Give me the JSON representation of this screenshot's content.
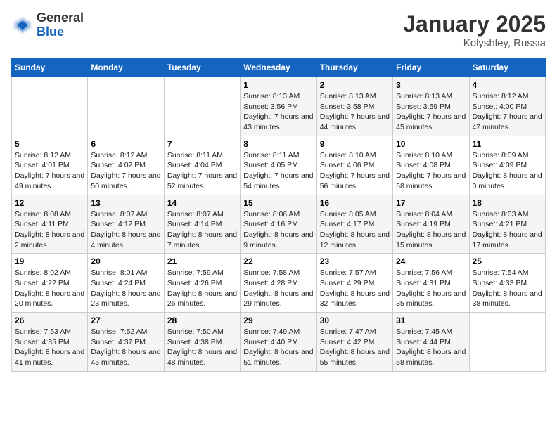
{
  "header": {
    "logo_general": "General",
    "logo_blue": "Blue",
    "month_title": "January 2025",
    "location": "Kolyshley, Russia"
  },
  "days_of_week": [
    "Sunday",
    "Monday",
    "Tuesday",
    "Wednesday",
    "Thursday",
    "Friday",
    "Saturday"
  ],
  "weeks": [
    [
      {
        "day": "",
        "sunrise": "",
        "sunset": "",
        "daylight": ""
      },
      {
        "day": "",
        "sunrise": "",
        "sunset": "",
        "daylight": ""
      },
      {
        "day": "",
        "sunrise": "",
        "sunset": "",
        "daylight": ""
      },
      {
        "day": "1",
        "sunrise": "Sunrise: 8:13 AM",
        "sunset": "Sunset: 3:56 PM",
        "daylight": "Daylight: 7 hours and 43 minutes."
      },
      {
        "day": "2",
        "sunrise": "Sunrise: 8:13 AM",
        "sunset": "Sunset: 3:58 PM",
        "daylight": "Daylight: 7 hours and 44 minutes."
      },
      {
        "day": "3",
        "sunrise": "Sunrise: 8:13 AM",
        "sunset": "Sunset: 3:59 PM",
        "daylight": "Daylight: 7 hours and 45 minutes."
      },
      {
        "day": "4",
        "sunrise": "Sunrise: 8:12 AM",
        "sunset": "Sunset: 4:00 PM",
        "daylight": "Daylight: 7 hours and 47 minutes."
      }
    ],
    [
      {
        "day": "5",
        "sunrise": "Sunrise: 8:12 AM",
        "sunset": "Sunset: 4:01 PM",
        "daylight": "Daylight: 7 hours and 49 minutes."
      },
      {
        "day": "6",
        "sunrise": "Sunrise: 8:12 AM",
        "sunset": "Sunset: 4:02 PM",
        "daylight": "Daylight: 7 hours and 50 minutes."
      },
      {
        "day": "7",
        "sunrise": "Sunrise: 8:11 AM",
        "sunset": "Sunset: 4:04 PM",
        "daylight": "Daylight: 7 hours and 52 minutes."
      },
      {
        "day": "8",
        "sunrise": "Sunrise: 8:11 AM",
        "sunset": "Sunset: 4:05 PM",
        "daylight": "Daylight: 7 hours and 54 minutes."
      },
      {
        "day": "9",
        "sunrise": "Sunrise: 8:10 AM",
        "sunset": "Sunset: 4:06 PM",
        "daylight": "Daylight: 7 hours and 56 minutes."
      },
      {
        "day": "10",
        "sunrise": "Sunrise: 8:10 AM",
        "sunset": "Sunset: 4:08 PM",
        "daylight": "Daylight: 7 hours and 58 minutes."
      },
      {
        "day": "11",
        "sunrise": "Sunrise: 8:09 AM",
        "sunset": "Sunset: 4:09 PM",
        "daylight": "Daylight: 8 hours and 0 minutes."
      }
    ],
    [
      {
        "day": "12",
        "sunrise": "Sunrise: 8:08 AM",
        "sunset": "Sunset: 4:11 PM",
        "daylight": "Daylight: 8 hours and 2 minutes."
      },
      {
        "day": "13",
        "sunrise": "Sunrise: 8:07 AM",
        "sunset": "Sunset: 4:12 PM",
        "daylight": "Daylight: 8 hours and 4 minutes."
      },
      {
        "day": "14",
        "sunrise": "Sunrise: 8:07 AM",
        "sunset": "Sunset: 4:14 PM",
        "daylight": "Daylight: 8 hours and 7 minutes."
      },
      {
        "day": "15",
        "sunrise": "Sunrise: 8:06 AM",
        "sunset": "Sunset: 4:16 PM",
        "daylight": "Daylight: 8 hours and 9 minutes."
      },
      {
        "day": "16",
        "sunrise": "Sunrise: 8:05 AM",
        "sunset": "Sunset: 4:17 PM",
        "daylight": "Daylight: 8 hours and 12 minutes."
      },
      {
        "day": "17",
        "sunrise": "Sunrise: 8:04 AM",
        "sunset": "Sunset: 4:19 PM",
        "daylight": "Daylight: 8 hours and 15 minutes."
      },
      {
        "day": "18",
        "sunrise": "Sunrise: 8:03 AM",
        "sunset": "Sunset: 4:21 PM",
        "daylight": "Daylight: 8 hours and 17 minutes."
      }
    ],
    [
      {
        "day": "19",
        "sunrise": "Sunrise: 8:02 AM",
        "sunset": "Sunset: 4:22 PM",
        "daylight": "Daylight: 8 hours and 20 minutes."
      },
      {
        "day": "20",
        "sunrise": "Sunrise: 8:01 AM",
        "sunset": "Sunset: 4:24 PM",
        "daylight": "Daylight: 8 hours and 23 minutes."
      },
      {
        "day": "21",
        "sunrise": "Sunrise: 7:59 AM",
        "sunset": "Sunset: 4:26 PM",
        "daylight": "Daylight: 8 hours and 26 minutes."
      },
      {
        "day": "22",
        "sunrise": "Sunrise: 7:58 AM",
        "sunset": "Sunset: 4:28 PM",
        "daylight": "Daylight: 8 hours and 29 minutes."
      },
      {
        "day": "23",
        "sunrise": "Sunrise: 7:57 AM",
        "sunset": "Sunset: 4:29 PM",
        "daylight": "Daylight: 8 hours and 32 minutes."
      },
      {
        "day": "24",
        "sunrise": "Sunrise: 7:56 AM",
        "sunset": "Sunset: 4:31 PM",
        "daylight": "Daylight: 8 hours and 35 minutes."
      },
      {
        "day": "25",
        "sunrise": "Sunrise: 7:54 AM",
        "sunset": "Sunset: 4:33 PM",
        "daylight": "Daylight: 8 hours and 38 minutes."
      }
    ],
    [
      {
        "day": "26",
        "sunrise": "Sunrise: 7:53 AM",
        "sunset": "Sunset: 4:35 PM",
        "daylight": "Daylight: 8 hours and 41 minutes."
      },
      {
        "day": "27",
        "sunrise": "Sunrise: 7:52 AM",
        "sunset": "Sunset: 4:37 PM",
        "daylight": "Daylight: 8 hours and 45 minutes."
      },
      {
        "day": "28",
        "sunrise": "Sunrise: 7:50 AM",
        "sunset": "Sunset: 4:38 PM",
        "daylight": "Daylight: 8 hours and 48 minutes."
      },
      {
        "day": "29",
        "sunrise": "Sunrise: 7:49 AM",
        "sunset": "Sunset: 4:40 PM",
        "daylight": "Daylight: 8 hours and 51 minutes."
      },
      {
        "day": "30",
        "sunrise": "Sunrise: 7:47 AM",
        "sunset": "Sunset: 4:42 PM",
        "daylight": "Daylight: 8 hours and 55 minutes."
      },
      {
        "day": "31",
        "sunrise": "Sunrise: 7:45 AM",
        "sunset": "Sunset: 4:44 PM",
        "daylight": "Daylight: 8 hours and 58 minutes."
      },
      {
        "day": "",
        "sunrise": "",
        "sunset": "",
        "daylight": ""
      }
    ]
  ]
}
